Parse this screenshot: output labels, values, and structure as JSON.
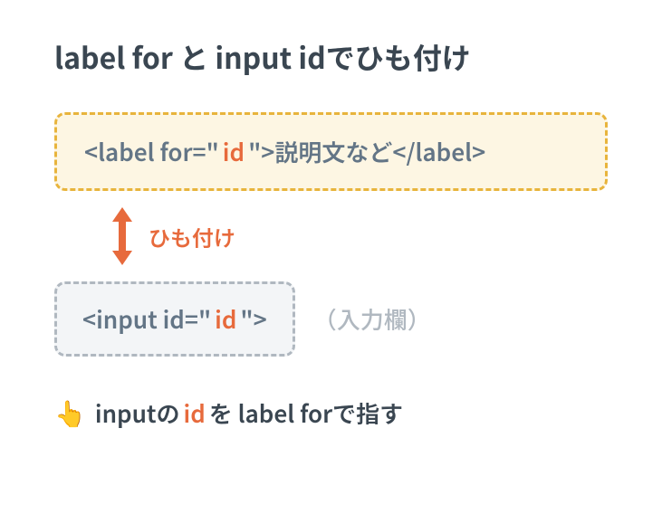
{
  "title": "label for と input idでひも付け",
  "label_box": {
    "open_tag_pre": "<label for=\"",
    "id": "id",
    "open_tag_post": "\">",
    "content": "説明文など",
    "close_tag": "</label>"
  },
  "connector": {
    "text": "ひも付け"
  },
  "input_box": {
    "pre": "<input id=\"",
    "id": "id",
    "post": "\">",
    "placeholder": "（入力欄）"
  },
  "footer": {
    "icon": "👆",
    "t1": "inputの",
    "id": " id ",
    "t2": "を label forで指す"
  },
  "colors": {
    "accent": "#e76a3c",
    "label_border": "#e8b43c",
    "label_bg": "#fdf6e3",
    "muted_border": "#b0b8c0"
  }
}
